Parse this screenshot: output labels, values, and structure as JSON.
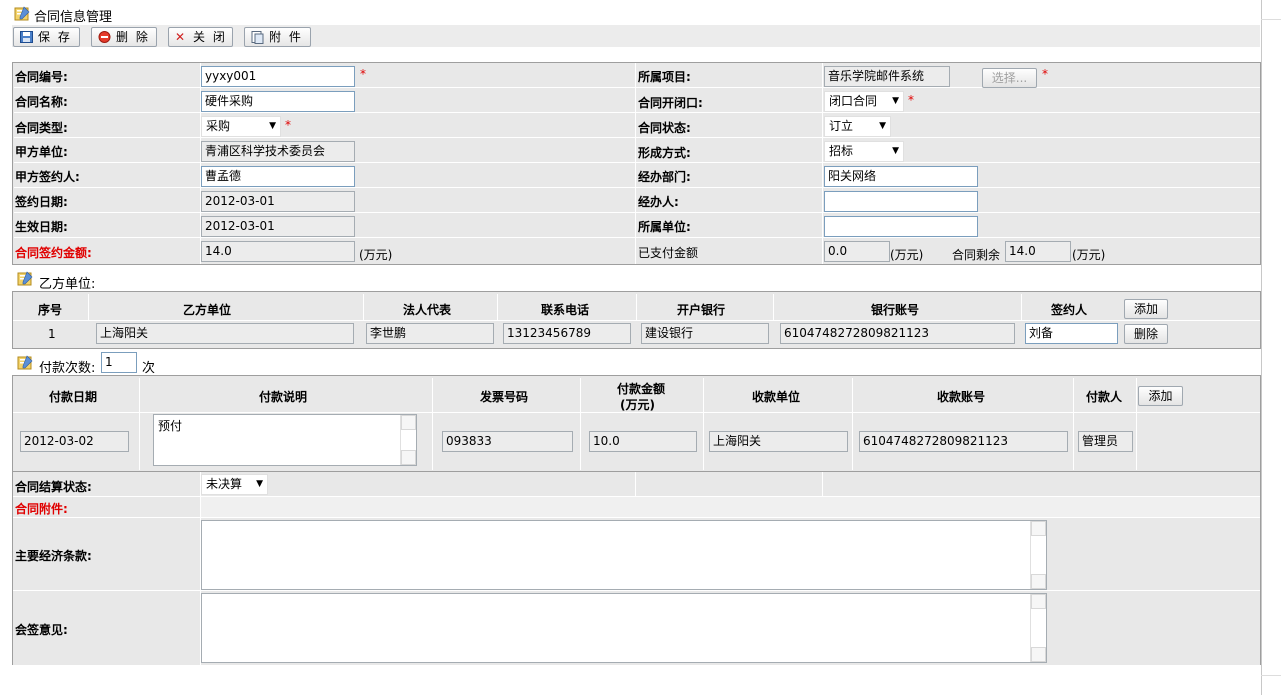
{
  "window": {
    "title": "合同信息管理"
  },
  "toolbar": {
    "save": "保 存",
    "delete": "删 除",
    "close": "关 闭",
    "attach": "附 件"
  },
  "form": {
    "contract_no": {
      "label": "合同编号:",
      "value": "yyxy001"
    },
    "contract_name": {
      "label": "合同名称:",
      "value": "硬件采购"
    },
    "contract_type": {
      "label": "合同类型:",
      "value": "采购"
    },
    "party_a_unit": {
      "label": "甲方单位:",
      "value": "青浦区科学技术委员会"
    },
    "party_a_signer": {
      "label": "甲方签约人:",
      "value": "曹孟德"
    },
    "sign_date": {
      "label": "签约日期:",
      "value": "2012-03-01"
    },
    "effective_date": {
      "label": "生效日期:",
      "value": "2012-03-01"
    },
    "amount": {
      "label": "合同签约金额:",
      "value": "14.0",
      "unit": "(万元)"
    },
    "project": {
      "label": "所属项目:",
      "value": "音乐学院邮件系统",
      "button": "选择..."
    },
    "open_close": {
      "label": "合同开闭口:",
      "value": "闭口合同"
    },
    "status": {
      "label": "合同状态:",
      "value": "订立"
    },
    "formation": {
      "label": "形成方式:",
      "value": "招标"
    },
    "department": {
      "label": "经办部门:",
      "value": "阳关网络"
    },
    "handler": {
      "label": "经办人:",
      "value": ""
    },
    "owner_unit": {
      "label": "所属单位:",
      "value": ""
    },
    "paid": {
      "label": "已支付金额",
      "value": "0.0",
      "unit": "(万元)"
    },
    "remaining": {
      "label": "合同剩余",
      "value": "14.0",
      "unit": "(万元)"
    },
    "settle_status": {
      "label": "合同结算状态:",
      "value": "未决算"
    },
    "attachments": {
      "label": "合同附件:"
    },
    "main_terms": {
      "label": "主要经济条款:",
      "value": ""
    },
    "opinion": {
      "label": "会签意见:",
      "value": ""
    }
  },
  "party_b": {
    "title": "乙方单位:",
    "headers": [
      "序号",
      "乙方单位",
      "法人代表",
      "联系电话",
      "开户银行",
      "银行账号",
      "签约人"
    ],
    "add_label": "添加",
    "delete_label": "删除",
    "rows": [
      {
        "no": "1",
        "unit": "上海阳关",
        "rep": "李世鹏",
        "phone": "13123456789",
        "bank": "建设银行",
        "account": "6104748272809821123",
        "signer": "刘备"
      }
    ]
  },
  "payment": {
    "title": "付款次数:",
    "count": "1",
    "count_suffix": "次",
    "headers": [
      "付款日期",
      "付款说明",
      "发票号码",
      "付款金额",
      "(万元)",
      "收款单位",
      "收款账号",
      "付款人"
    ],
    "add_label": "添加",
    "rows": [
      {
        "date": "2012-03-02",
        "desc": "预付",
        "invoice": "093833",
        "amount": "10.0",
        "payee": "上海阳关",
        "account": "6104748272809821123",
        "payer": "管理员"
      }
    ]
  }
}
